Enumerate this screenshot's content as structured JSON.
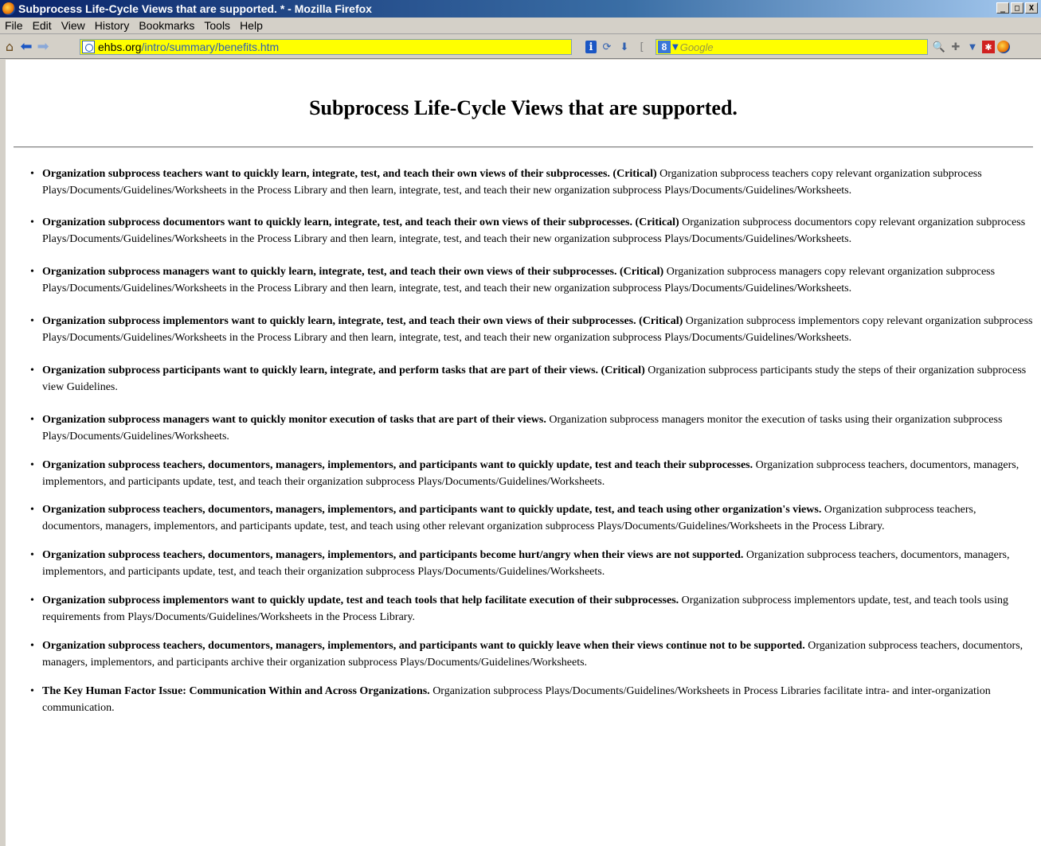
{
  "window": {
    "title": "Subprocess Life-Cycle Views that are supported. * - Mozilla Firefox",
    "min_btn": "_",
    "max_btn": "□",
    "close_btn": "X"
  },
  "menu": [
    "File",
    "Edit",
    "View",
    "History",
    "Bookmarks",
    "Tools",
    "Help"
  ],
  "address": {
    "domain": "ehbs.org",
    "path": "/intro/summary/benefits.htm"
  },
  "search": {
    "engine": "8",
    "placeholder": "Google"
  },
  "page": {
    "heading": "Subprocess Life-Cycle Views that are supported.",
    "items": [
      {
        "bold": "Organization subprocess teachers want to quickly learn, integrate, test, and teach their own views of their subprocesses. (Critical)",
        "text": " Organization subprocess teachers copy relevant organization subprocess Plays/Documents/Guidelines/Worksheets in the Process Library and then learn, integrate, test, and teach their new organization subprocess Plays/Documents/Guidelines/Worksheets."
      },
      {
        "bold": "Organization subprocess documentors want to quickly learn, integrate, test, and teach their own views of their subprocesses. (Critical)",
        "text": " Organization subprocess documentors copy relevant organization subprocess Plays/Documents/Guidelines/Worksheets in the Process Library and then learn, integrate, test, and teach their new organization subprocess Plays/Documents/Guidelines/Worksheets."
      },
      {
        "bold": "Organization subprocess managers want to quickly learn, integrate, test, and teach their own views of their subprocesses. (Critical)",
        "text": " Organization subprocess managers copy relevant organization subprocess Plays/Documents/Guidelines/Worksheets in the Process Library and then learn, integrate, test, and teach their new organization subprocess Plays/Documents/Guidelines/Worksheets."
      },
      {
        "bold": "Organization subprocess implementors want to quickly learn, integrate, test, and teach their own views of their subprocesses. (Critical)",
        "text": " Organization subprocess implementors copy relevant organization subprocess Plays/Documents/Guidelines/Worksheets in the Process Library and then learn, integrate, test, and teach their new organization subprocess Plays/Documents/Guidelines/Worksheets."
      },
      {
        "bold": "Organization subprocess participants want to quickly learn, integrate, and perform tasks that are part of their views. (Critical)",
        "text": " Organization subprocess participants study the steps of their organization subprocess view Guidelines."
      },
      {
        "bold": "Organization subprocess managers want to quickly monitor execution of tasks that are part of their views.",
        "text": " Organization subprocess managers monitor the execution of tasks using their organization subprocess Plays/Documents/Guidelines/Worksheets."
      },
      {
        "bold": "Organization subprocess teachers, documentors, managers, implementors, and participants want to quickly update, test and teach their subprocesses.",
        "text": " Organization subprocess teachers, documentors, managers, implementors, and participants update, test, and teach their organization subprocess Plays/Documents/Guidelines/Worksheets."
      },
      {
        "bold": "Organization subprocess teachers, documentors, managers, implementors, and participants want to quickly update, test, and teach using other organization's views.",
        "text": " Organization subprocess teachers, documentors, managers, implementors, and participants update, test, and teach using other relevant organization subprocess Plays/Documents/Guidelines/Worksheets in the Process Library."
      },
      {
        "bold": "Organization subprocess teachers, documentors, managers, implementors, and participants become hurt/angry when their views are not supported.",
        "text": " Organization subprocess teachers, documentors, managers, implementors, and participants update, test, and teach their organization subprocess Plays/Documents/Guidelines/Worksheets."
      },
      {
        "bold": "Organization subprocess implementors want to quickly update, test and teach tools that help facilitate execution of their subprocesses.",
        "text": " Organization subprocess implementors update, test, and teach tools using requirements from Plays/Documents/Guidelines/Worksheets in the Process Library."
      },
      {
        "bold": "Organization subprocess teachers, documentors, managers, implementors, and participants want to quickly leave when their views continue not to be supported.",
        "text": " Organization subprocess teachers, documentors, managers, implementors, and participants archive their organization subprocess Plays/Documents/Guidelines/Worksheets."
      },
      {
        "bold": "The Key Human Factor Issue: Communication Within and Across Organizations.",
        "text": " Organization subprocess Plays/Documents/Guidelines/Worksheets in Process Libraries facilitate intra- and inter-organization communication."
      }
    ]
  }
}
